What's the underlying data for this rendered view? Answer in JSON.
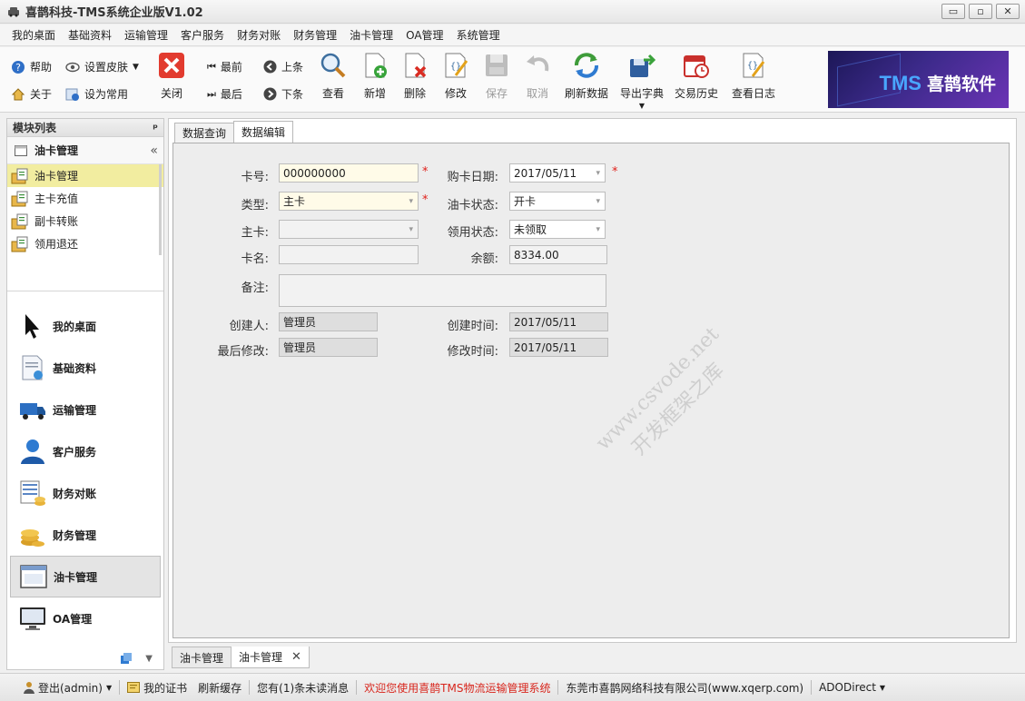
{
  "window": {
    "title": "喜鹊科技-TMS系统企业版V1.02",
    "minimize": "▭",
    "maximize": "▫",
    "close": "✕"
  },
  "menu": [
    "我的桌面",
    "基础资料",
    "运输管理",
    "客户服务",
    "财务对账",
    "财务管理",
    "油卡管理",
    "OA管理",
    "系统管理"
  ],
  "toolbar": {
    "help": "帮助",
    "skin": "设置皮肤",
    "about": "关于",
    "favorite": "设为常用",
    "close": "关闭",
    "first": "最前",
    "last": "最后",
    "prev": "上条",
    "next": "下条",
    "view": "查看",
    "add": "新增",
    "delete": "删除",
    "edit": "修改",
    "save": "保存",
    "cancel": "取消",
    "refresh": "刷新数据",
    "export": "导出字典",
    "history": "交易历史",
    "log": "查看日志",
    "logo": {
      "tms": "TMS",
      "name": "喜鹊软件"
    }
  },
  "sidebar": {
    "header": "模块列表",
    "pin": "ᵖ",
    "group": "油卡管理",
    "collapse": "«",
    "items": [
      {
        "label": "油卡管理",
        "selected": true
      },
      {
        "label": "主卡充值",
        "selected": false
      },
      {
        "label": "副卡转账",
        "selected": false
      },
      {
        "label": "领用退还",
        "selected": false
      }
    ],
    "nav": [
      {
        "label": "我的桌面",
        "icon": "cursor-icon",
        "active": false
      },
      {
        "label": "基础资料",
        "icon": "document-icon",
        "active": false
      },
      {
        "label": "运输管理",
        "icon": "truck-icon",
        "active": false
      },
      {
        "label": "客户服务",
        "icon": "person-icon",
        "active": false
      },
      {
        "label": "财务对账",
        "icon": "calculator-icon",
        "active": false
      },
      {
        "label": "财务管理",
        "icon": "coins-icon",
        "active": false
      },
      {
        "label": "油卡管理",
        "icon": "window-icon",
        "active": true
      },
      {
        "label": "OA管理",
        "icon": "monitor-icon",
        "active": false
      }
    ]
  },
  "tabs": [
    {
      "label": "数据查询",
      "active": false
    },
    {
      "label": "数据编辑",
      "active": true
    }
  ],
  "form": {
    "card_no_label": "卡号:",
    "card_no": "000000000",
    "purchase_date_label": "购卡日期:",
    "purchase_date": "2017/05/11",
    "type_label": "类型:",
    "type": "主卡",
    "status_label": "油卡状态:",
    "status": "开卡",
    "main_card_label": "主卡:",
    "main_card": "",
    "collect_status_label": "领用状态:",
    "collect_status": "未领取",
    "card_name_label": "卡名:",
    "card_name": "",
    "balance_label": "余额:",
    "balance": "8334.00",
    "remark_label": "备注:",
    "remark": "",
    "creator_label": "创建人:",
    "creator": "管理员",
    "created_time_label": "创建时间:",
    "created_time": "2017/05/11",
    "modifier_label": "最后修改:",
    "modifier": "管理员",
    "modified_time_label": "修改时间:",
    "modified_time": "2017/05/11",
    "required": "*"
  },
  "watermark": {
    "line1": "www.csvode.net",
    "line2": "开发框架之库"
  },
  "doc_tabs": [
    {
      "label": "油卡管理",
      "active": false
    },
    {
      "label": "油卡管理",
      "active": true
    }
  ],
  "doc_tab_close": "✕",
  "statusbar": {
    "logout": "登出(admin)",
    "cert": "我的证书",
    "refresh_cache": "刷新缓存",
    "messages": "您有(1)条未读消息",
    "welcome": "欢迎您使用喜鹊TMS物流运输管理系统",
    "company": "东莞市喜鹊网络科技有限公司(www.xqerp.com)",
    "db": "ADODirect"
  },
  "colors": {
    "required": "#e0201a",
    "selected_row": "#f2eda0",
    "welcome_text": "#d8261d"
  }
}
